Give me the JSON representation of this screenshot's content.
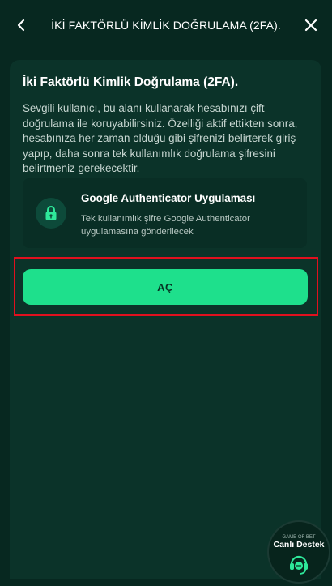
{
  "header": {
    "title": "İKİ FAKTÖRLÜ KİMLİK DOĞRULAMA (2FA).",
    "back_icon": "chevron-left-icon",
    "close_icon": "close-icon"
  },
  "card": {
    "title": "İki Faktörlü Kimlik Doğrulama (2FA).",
    "description": "Sevgili kullanıcı, bu alanı kullanarak hesabınızı çift doğrulama ile koruyabilirsiniz. Özelliği aktif ettikten sonra, hesabınıza her zaman olduğu gibi şifrenizi belirterek giriş yapıp, daha sonra tek kullanımlık doğrulama şifresini belirtmeniz gerekecektir."
  },
  "authenticator": {
    "title": "Google Authenticator Uygulaması",
    "description": "Tek kullanımlık şifre Google Authenticator uygulamasına gönderilecek",
    "icon": "lock-icon"
  },
  "action": {
    "button_label": "AÇ"
  },
  "support": {
    "brand": "GAME OF BET",
    "label": "Canlı Destek",
    "icon": "headset-icon"
  },
  "colors": {
    "background": "#072820",
    "card": "#0b3329",
    "accent": "#1ee08c",
    "highlight": "#e0101e"
  }
}
